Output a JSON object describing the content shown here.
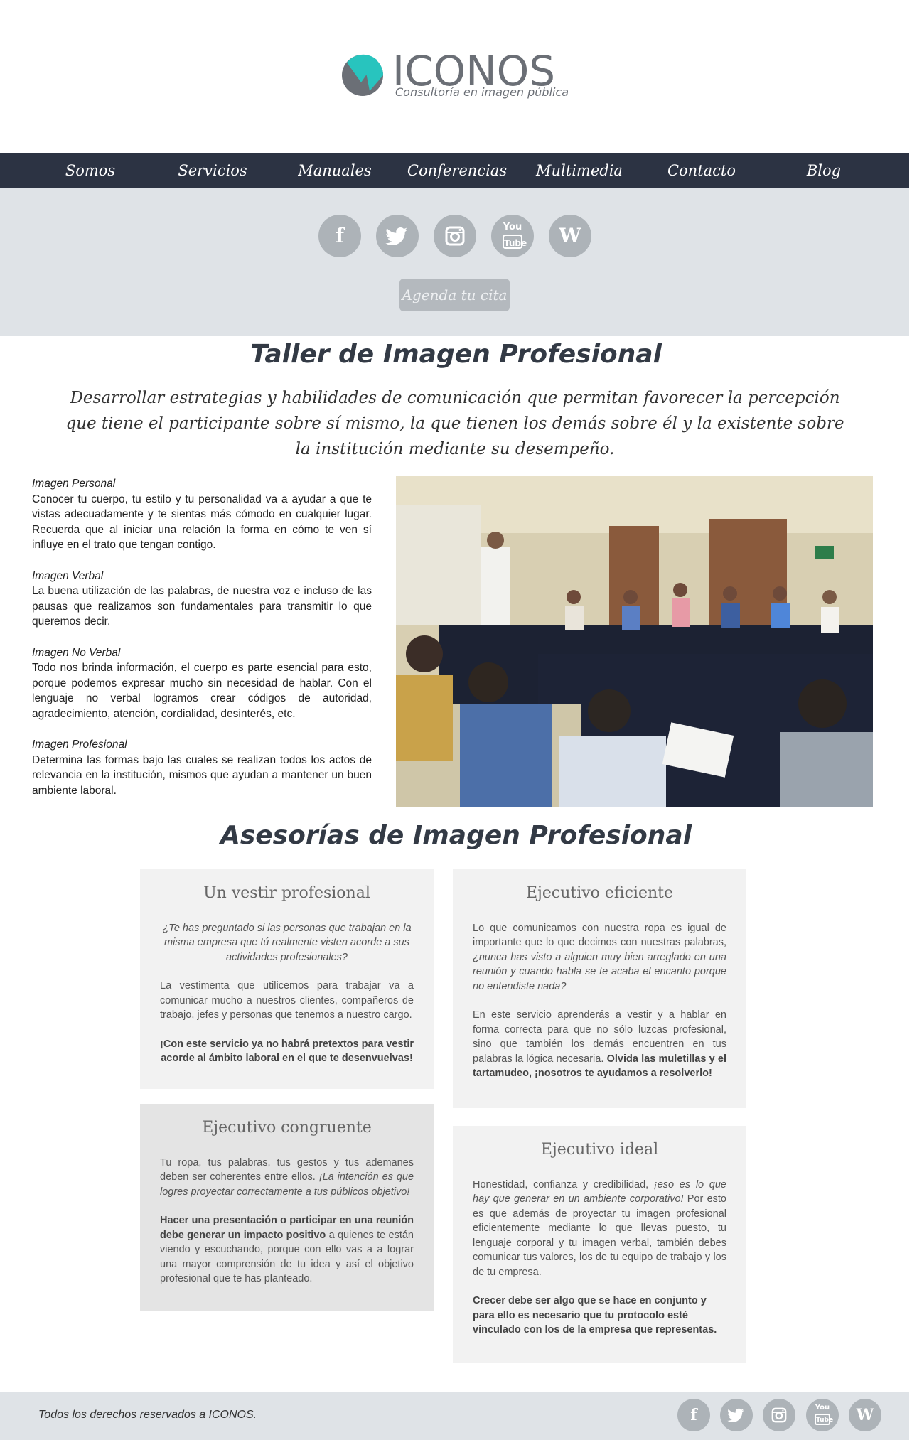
{
  "brand": {
    "name": "ICONOS",
    "tagline": "Consultoría en imagen pública",
    "colors": {
      "teal": "#28c4be",
      "gray": "#6b6f76",
      "nav": "#2c3343",
      "band": "#dfe3e7"
    }
  },
  "nav": {
    "items": [
      "Somos",
      "Servicios",
      "Manuales",
      "Conferencias",
      "Multimedia",
      "Contacto",
      "Blog"
    ]
  },
  "social": {
    "icons": [
      "facebook-icon",
      "twitter-icon",
      "instagram-icon",
      "youtube-icon",
      "wordpress-icon"
    ],
    "glyphs": {
      "facebook": "f",
      "wordpress": "W",
      "youtube_top": "You",
      "youtube_bottom": "Tube"
    }
  },
  "cta": {
    "label": "Agenda tu cita"
  },
  "workshop": {
    "title": "Taller de Imagen Profesional",
    "subtitle": "Desarrollar estrategias y habilidades de comunicación que permitan favorecer la percepción que tiene el participante sobre sí mismo, la que tienen los demás sobre él y la existente sobre la institución mediante su desempeño.",
    "topics": [
      {
        "title": "Imagen Personal",
        "text": "Conocer tu cuerpo, tu estilo y tu personalidad va a ayudar a que te vistas adecuadamente y te sientas más cómodo en cualquier lugar. Recuerda que al iniciar una relación la forma en cómo te ven sí influye en el trato que tengan contigo."
      },
      {
        "title": "Imagen Verbal",
        "text": "La buena utilización de las palabras, de nuestra voz e incluso de las pausas que realizamos son fundamentales para transmitir lo que queremos decir."
      },
      {
        "title": "Imagen No Verbal",
        "text": "Todo nos brinda información, el cuerpo es parte esencial para esto, porque podemos expresar mucho sin necesidad de hablar. Con el lenguaje no verbal logramos crear códigos de autoridad, agradecimiento, atención, cordialidad, desinterés, etc."
      },
      {
        "title": "Imagen Profesional",
        "text": "Determina las formas bajo las cuales se realizan todos los actos de relevancia en la institución, mismos que ayudan a mantener un buen ambiente laboral."
      }
    ]
  },
  "advisory": {
    "title": "Asesorías de Imagen Profesional",
    "cards": {
      "vestir": {
        "title": "Un vestir profesional",
        "p1": "¿Te has preguntado si las personas que trabajan en la misma empresa que tú realmente visten acorde a sus actividades profesionales?",
        "p2": "La vestimenta que utilicemos para trabajar va a comunicar mucho a nuestros clientes, compañeros de trabajo, jefes y personas que tenemos a nuestro cargo.",
        "p3": "¡Con este servicio ya no habrá pretextos para vestir acorde al ámbito laboral en el que te desenvuelvas!"
      },
      "eficiente": {
        "title": "Ejecutivo eficiente",
        "p1a": "Lo que comunicamos con nuestra ropa es igual de importante que lo que decimos con nuestras palabras, ",
        "p1b": "¿nunca has visto a alguien muy bien arreglado en una reunión y cuando habla se te acaba el encanto porque no entendiste nada?",
        "p2a": "En este servicio aprenderás a vestir y a hablar en forma correcta para que no sólo luzcas profesional, sino que también los demás encuentren en tus palabras la lógica necesaria. ",
        "p2b": "Olvida las muletillas y el tartamudeo, ¡nosotros te ayudamos a resolverlo!"
      },
      "congruente": {
        "title": "Ejecutivo congruente",
        "p1a": "Tu ropa, tus palabras, tus gestos y tus ademanes deben ser coherentes entre ellos. ",
        "p1b": "¡La intención es que logres proyectar correctamente a tus públicos objetivo!",
        "p2a": "Hacer una presentación o participar en una reunión debe generar un impacto positivo",
        "p2b": " a quienes te están viendo y escuchando, porque con ello vas a a lograr una mayor comprensión de tu idea y así el objetivo profesional que te has planteado."
      },
      "ideal": {
        "title": "Ejecutivo ideal",
        "p1a": "Honestidad, confianza y credibilidad, ",
        "p1b": "¡eso es lo que hay que generar en un ambiente corporativo!",
        "p1c": " Por esto es que además de proyectar tu imagen profesional eficientemente mediante lo que llevas puesto, tu lenguaje corporal y tu imagen verbal, también debes comunicar tus valores, los de tu equipo de trabajo y los de tu empresa.",
        "p2": "Crecer debe ser algo que se hace en conjunto y para ello es necesario que tu protocolo esté vinculado con los de la empresa que representas."
      }
    }
  },
  "footer": {
    "text": "Todos los derechos reservados a ICONOS."
  }
}
